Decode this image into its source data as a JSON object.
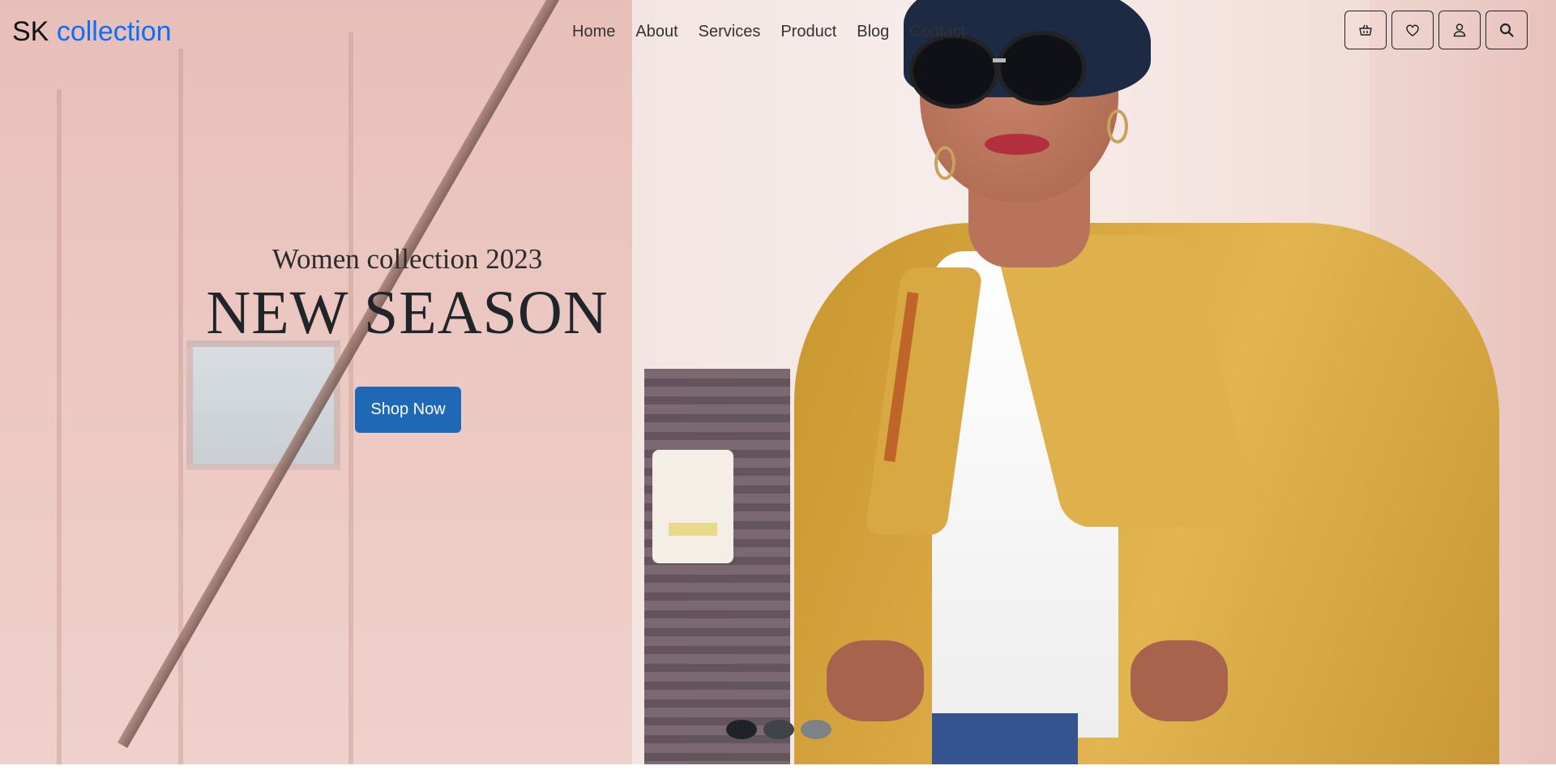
{
  "navbar": {
    "brand_prefix": "SK",
    "brand_accent": "collection",
    "links": [
      {
        "label": "Home"
      },
      {
        "label": "About"
      },
      {
        "label": "Services"
      },
      {
        "label": "Product"
      },
      {
        "label": "Blog"
      },
      {
        "label": "Contact"
      }
    ],
    "icons": [
      "basket-icon",
      "heart-icon",
      "user-icon",
      "search-icon"
    ]
  },
  "hero": {
    "subtitle": "Women collection 2023",
    "title": "NEW SEASON",
    "cta_label": "Shop Now"
  },
  "carousel": {
    "slide_count": 3,
    "active_index": 0
  },
  "colors": {
    "brand_accent": "#0d6efd",
    "cta_background": "#1f68b6",
    "coat": "#d9a843"
  }
}
